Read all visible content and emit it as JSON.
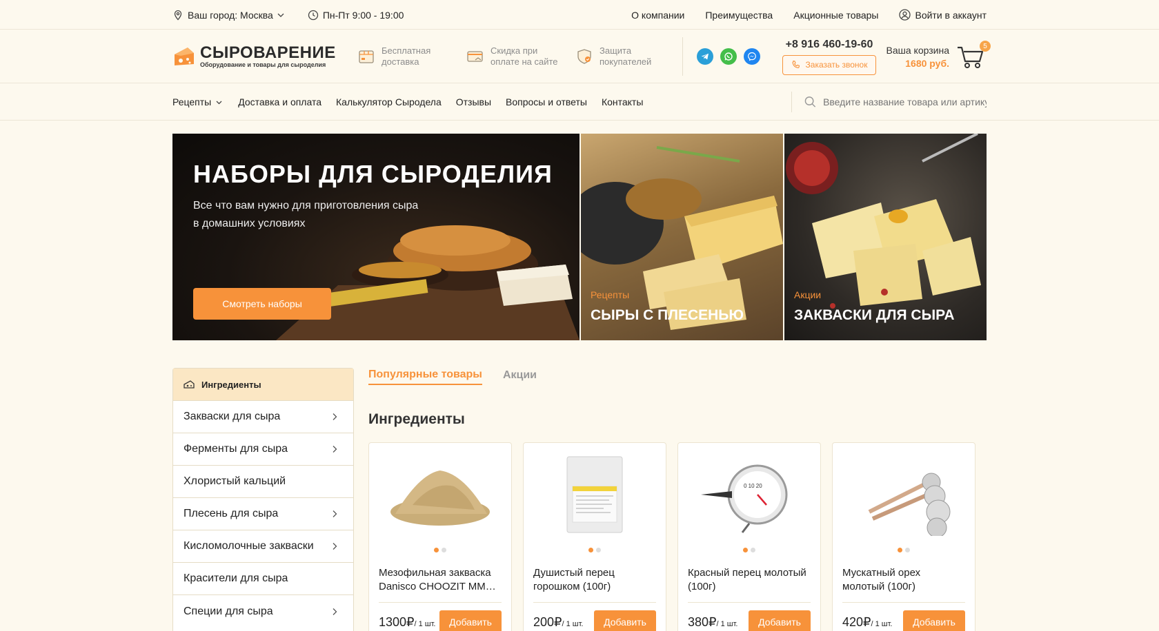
{
  "topbar": {
    "city": "Ваш город: Москва",
    "hours": "Пн-Пт 9:00 - 19:00",
    "links": [
      "О компании",
      "Преимущества",
      "Акционные товары"
    ],
    "login": "Войти в аккаунт"
  },
  "header": {
    "logo_name": "СЫРОВАРЕНИЕ",
    "logo_tagline": "Оборудование и товары для сыроделия",
    "features": [
      {
        "line1": "Бесплатная",
        "line2": "доставка"
      },
      {
        "line1": "Скидка при",
        "line2": "оплате на сайте"
      },
      {
        "line1": "Защита",
        "line2": "покупателей"
      }
    ],
    "phone": "+8 916 460-19-60",
    "callback": "Заказать звонок",
    "cart_label": "Ваша корзина",
    "cart_total": "1680 руб.",
    "cart_count": "5"
  },
  "nav": {
    "items": [
      "Рецепты",
      "Доставка и оплата",
      "Калькулятор Сыродела",
      "Отзывы",
      "Вопросы и ответы",
      "Контакты"
    ],
    "search_placeholder": "Введите название товара или артикул"
  },
  "hero": {
    "title": "НАБОРЫ ДЛЯ СЫРОДЕЛИЯ",
    "line1": "Все что вам нужно для приготовления сыра",
    "line2": "в домашних условиях",
    "button": "Смотреть наборы"
  },
  "side_banners": [
    {
      "category": "Рецепты",
      "title": "СЫРЫ С ПЛЕСЕНЬЮ"
    },
    {
      "category": "Акции",
      "title": "ЗАКВАСКИ ДЛЯ СЫРА"
    }
  ],
  "sidebar": {
    "heading": "Ингредиенты",
    "items": [
      {
        "label": "Закваски для сыра",
        "arrow": true
      },
      {
        "label": "Ферменты для сыра",
        "arrow": true
      },
      {
        "label": "Хлористый кальций",
        "arrow": false
      },
      {
        "label": "Плесень для сыра",
        "arrow": true
      },
      {
        "label": "Кисломолочные закваски",
        "arrow": true
      },
      {
        "label": "Красители для сыра",
        "arrow": false
      },
      {
        "label": "Специи для сыра",
        "arrow": true
      }
    ]
  },
  "tabs": [
    "Популярные товары",
    "Акции"
  ],
  "section_title": "Ингредиенты",
  "products": [
    {
      "line1": "Мезофильная закваска",
      "line2": "Danisco CHOOZIT MM…",
      "price": "1300₽",
      "unit": "/ 1 шт.",
      "button": "Добавить",
      "image": "powder"
    },
    {
      "line1": "Душистый перец",
      "line2": "горошком (100г)",
      "price": "200₽",
      "unit": "/ 1 шт.",
      "button": "Добавить",
      "image": "packet"
    },
    {
      "line1": "Красный перец молотый",
      "line2": "(100г)",
      "price": "380₽",
      "unit": "/ 1 шт.",
      "button": "Добавить",
      "image": "thermometer"
    },
    {
      "line1": "Мускатный орех",
      "line2": "молотый (100г)",
      "price": "420₽",
      "unit": "/ 1 шт.",
      "button": "Добавить",
      "image": "spoons"
    }
  ],
  "colors": {
    "accent": "#f7923a",
    "background": "#fdf9ee",
    "sidebar_head": "#fbe7c4"
  }
}
